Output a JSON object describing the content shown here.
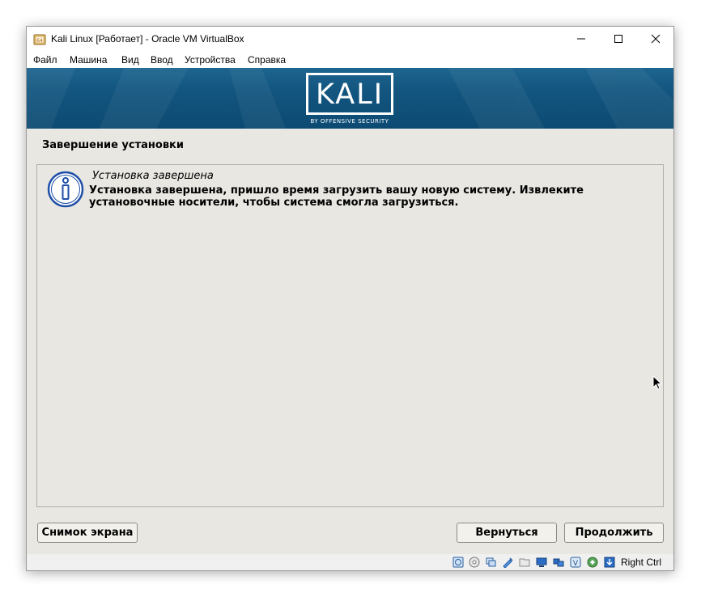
{
  "window": {
    "title": "Kali Linux [Работает] - Oracle VM VirtualBox",
    "controls": [
      "minimize-icon",
      "maximize-icon",
      "close-icon"
    ]
  },
  "menu": {
    "items": [
      "Файл",
      "Машина",
      "Вид",
      "Ввод",
      "Устройства",
      "Справка"
    ]
  },
  "banner": {
    "logo_text": "KALI",
    "logo_subtext": "BY OFFENSIVE SECURITY",
    "colors": {
      "top": "#1d6590",
      "bottom": "#0c4a72"
    }
  },
  "installer": {
    "section_title": "Завершение установки",
    "message_heading": "Установка завершена",
    "message_body": "Установка завершена, пришло время загрузить вашу новую систему. Извлеките установочные носители, чтобы система смогла загрузиться.",
    "buttons": {
      "screenshot": "Снимок экрана",
      "back": "Вернуться",
      "continue": "Продолжить"
    }
  },
  "statusbar": {
    "icons": [
      "hard-disk-icon",
      "optical-drive-icon",
      "audio-icon",
      "usb-icon",
      "shared-folders-icon",
      "display-icon",
      "network-icon",
      "recording-icon",
      "cpu-icon",
      "mouse-integration-icon"
    ],
    "host_key": "Right Ctrl"
  }
}
